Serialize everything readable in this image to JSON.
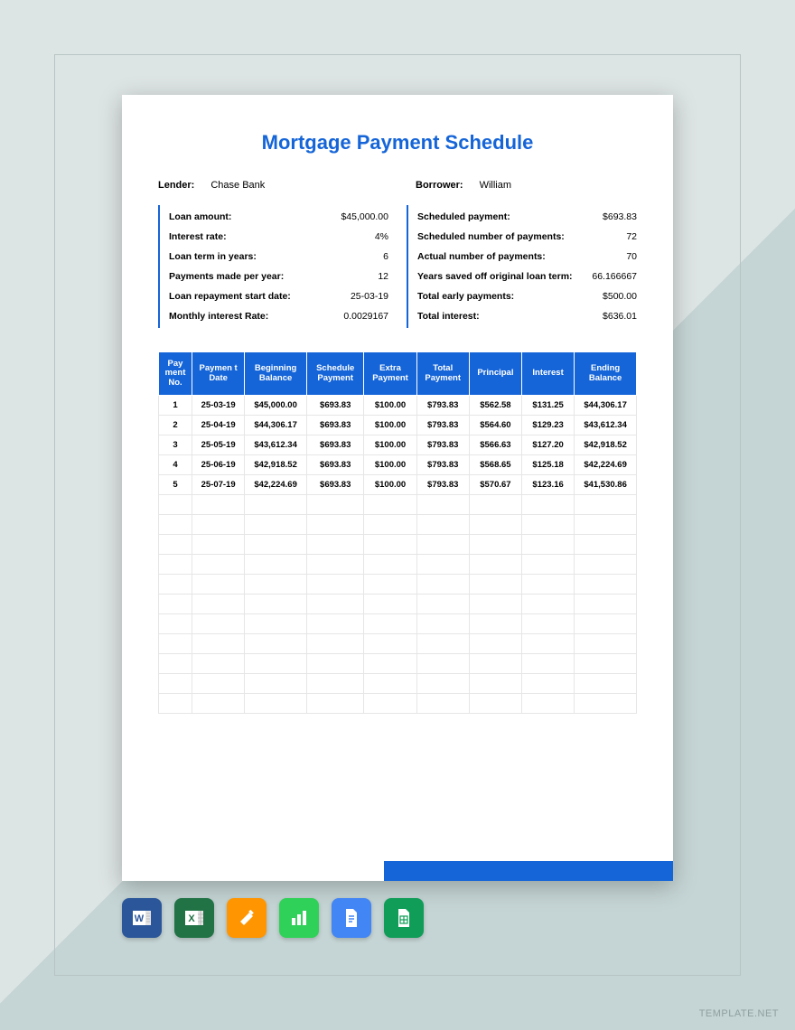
{
  "title": "Mortgage Payment Schedule",
  "parties": {
    "lender_label": "Lender:",
    "lender_value": "Chase Bank",
    "borrower_label": "Borrower:",
    "borrower_value": "William"
  },
  "info_left": [
    {
      "k": "Loan amount:",
      "v": "$45,000.00"
    },
    {
      "k": "Interest rate:",
      "v": "4%"
    },
    {
      "k": "Loan term in years:",
      "v": "6"
    },
    {
      "k": "Payments made per year:",
      "v": "12"
    },
    {
      "k": "Loan repayment start date:",
      "v": "25-03-19"
    },
    {
      "k": "Monthly interest Rate:",
      "v": "0.0029167"
    }
  ],
  "info_right": [
    {
      "k": "Scheduled payment:",
      "v": "$693.83"
    },
    {
      "k": "Scheduled number of payments:",
      "v": "72"
    },
    {
      "k": "Actual number of payments:",
      "v": "70"
    },
    {
      "k": "Years saved off original loan term:",
      "v": "66.166667"
    },
    {
      "k": "Total early payments:",
      "v": "$500.00"
    },
    {
      "k": "Total interest:",
      "v": "$636.01"
    }
  ],
  "table": {
    "headers": [
      "Pay ment No.",
      "Paymen t Date",
      "Beginning Balance",
      "Schedule Payment",
      "Extra Payment",
      "Total Payment",
      "Principal",
      "Interest",
      "Ending Balance"
    ],
    "rows": [
      [
        "1",
        "25-03-19",
        "$45,000.00",
        "$693.83",
        "$100.00",
        "$793.83",
        "$562.58",
        "$131.25",
        "$44,306.17"
      ],
      [
        "2",
        "25-04-19",
        "$44,306.17",
        "$693.83",
        "$100.00",
        "$793.83",
        "$564.60",
        "$129.23",
        "$43,612.34"
      ],
      [
        "3",
        "25-05-19",
        "$43,612.34",
        "$693.83",
        "$100.00",
        "$793.83",
        "$566.63",
        "$127.20",
        "$42,918.52"
      ],
      [
        "4",
        "25-06-19",
        "$42,918.52",
        "$693.83",
        "$100.00",
        "$793.83",
        "$568.65",
        "$125.18",
        "$42,224.69"
      ],
      [
        "5",
        "25-07-19",
        "$42,224.69",
        "$693.83",
        "$100.00",
        "$793.83",
        "$570.67",
        "$123.16",
        "$41,530.86"
      ]
    ],
    "empty_rows": 11
  },
  "watermark": "TEMPLATE.NET",
  "apps": [
    "word",
    "excel",
    "pages",
    "numbers",
    "gdocs",
    "gsheets"
  ]
}
